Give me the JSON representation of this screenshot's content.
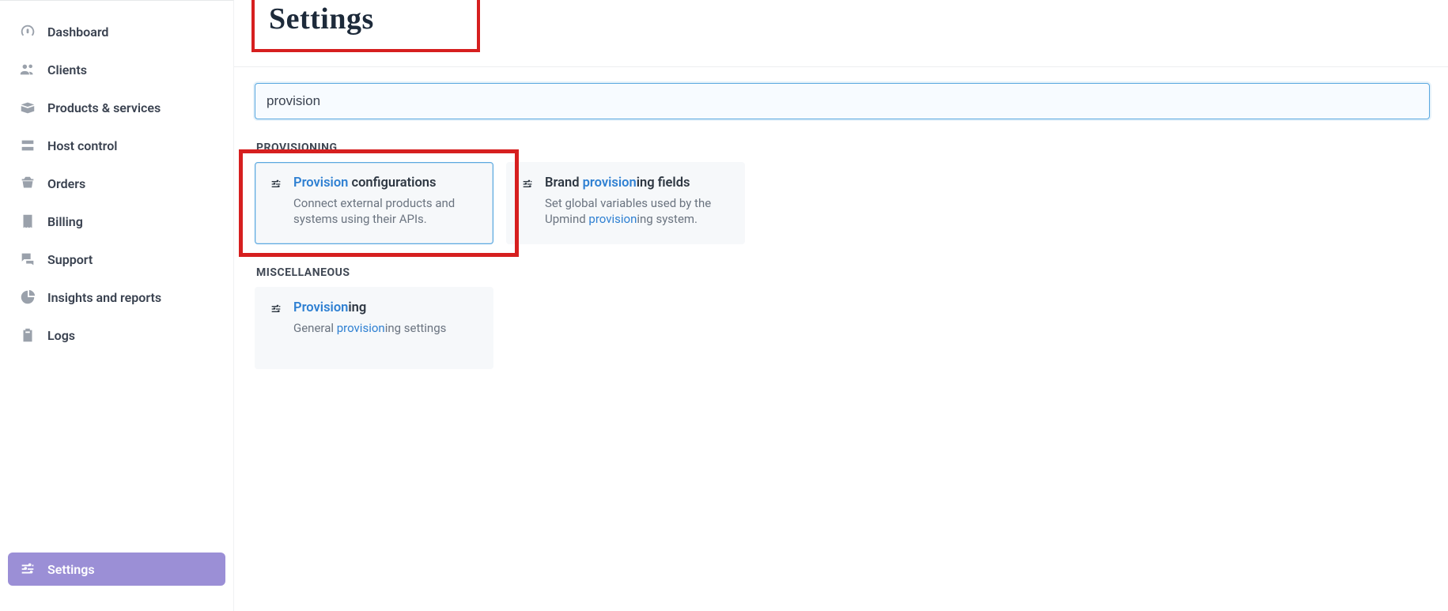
{
  "page": {
    "title": "Settings"
  },
  "search": {
    "value": "provision",
    "placeholder": ""
  },
  "sidebar": {
    "items": [
      {
        "label": "Dashboard"
      },
      {
        "label": "Clients"
      },
      {
        "label": "Products & services"
      },
      {
        "label": "Host control"
      },
      {
        "label": "Orders"
      },
      {
        "label": "Billing"
      },
      {
        "label": "Support"
      },
      {
        "label": "Insights and reports"
      },
      {
        "label": "Logs"
      }
    ],
    "active": {
      "label": "Settings"
    }
  },
  "sections": {
    "provisioning": {
      "header": "PROVISIONING",
      "cards": [
        {
          "title_hl": "Provision",
          "title_rest": " configurations",
          "desc": "Connect external products and systems using their APIs."
        },
        {
          "title_pre": "Brand ",
          "title_hl": "provision",
          "title_rest": "ing fields",
          "desc_pre": "Set global variables used by the Upmind ",
          "desc_hl": "provision",
          "desc_rest": "ing system."
        }
      ]
    },
    "misc": {
      "header": "MISCELLANEOUS",
      "cards": [
        {
          "title_hl": "Provision",
          "title_rest": "ing",
          "desc_pre": "General ",
          "desc_hl": "provision",
          "desc_rest": "ing settings"
        }
      ]
    }
  }
}
